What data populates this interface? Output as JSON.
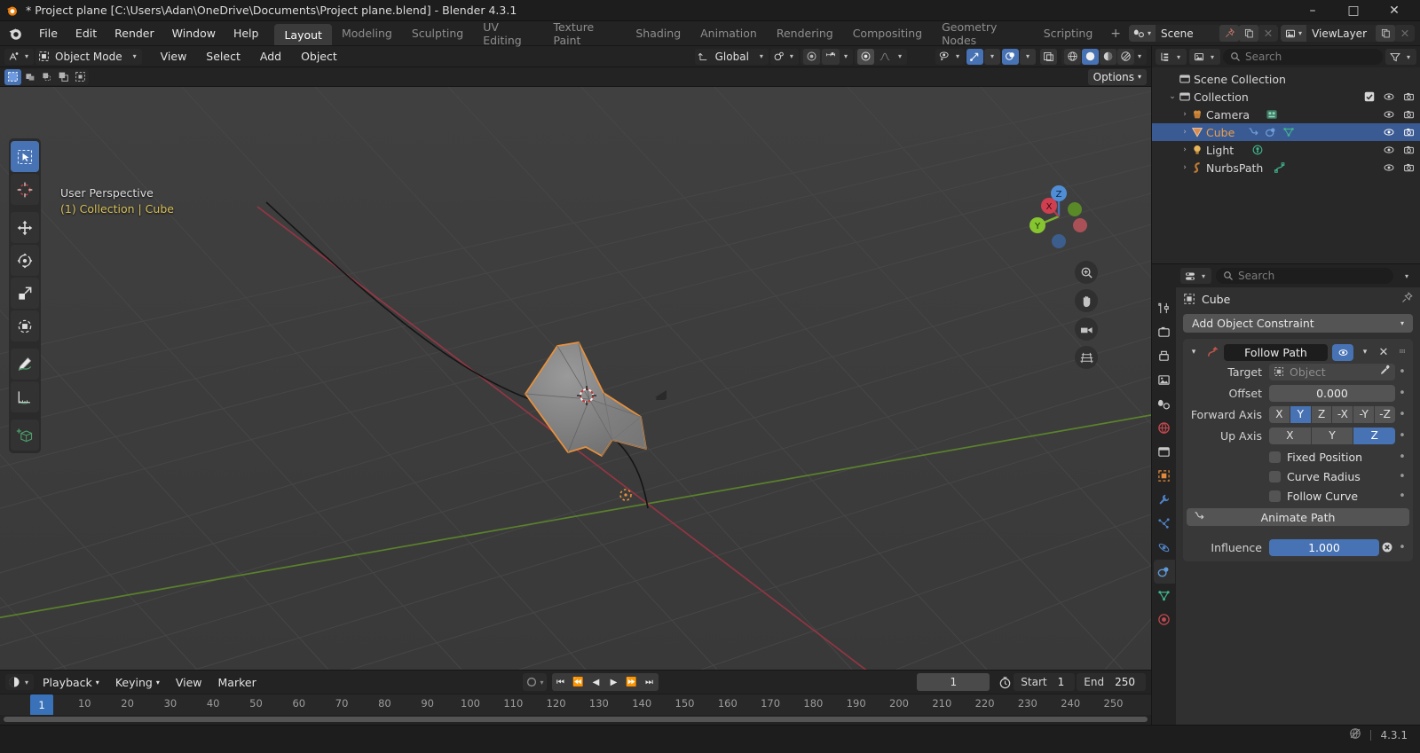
{
  "titlebar": {
    "text": "* Project plane [C:\\Users\\Adan\\OneDrive\\Documents\\Project plane.blend] - Blender 4.3.1",
    "minimize": "–",
    "maximize": "□",
    "close": "✕"
  },
  "topbar": {
    "menus": [
      "File",
      "Edit",
      "Render",
      "Window",
      "Help"
    ],
    "workspaces": [
      {
        "label": "Layout",
        "active": true
      },
      {
        "label": "Modeling",
        "active": false
      },
      {
        "label": "Sculpting",
        "active": false
      },
      {
        "label": "UV Editing",
        "active": false
      },
      {
        "label": "Texture Paint",
        "active": false
      },
      {
        "label": "Shading",
        "active": false
      },
      {
        "label": "Animation",
        "active": false
      },
      {
        "label": "Rendering",
        "active": false
      },
      {
        "label": "Compositing",
        "active": false
      },
      {
        "label": "Geometry Nodes",
        "active": false
      },
      {
        "label": "Scripting",
        "active": false
      }
    ],
    "add_workspace": "+",
    "scene_name": "Scene",
    "viewlayer_name": "ViewLayer"
  },
  "viewport_header": {
    "mode": "Object Mode",
    "menus": [
      "View",
      "Select",
      "Add",
      "Object"
    ],
    "transform_orientation": "Global",
    "options_label": "Options"
  },
  "viewport": {
    "perspective_text": "User Perspective",
    "collection_text": "(1) Collection | Cube",
    "gizmo_axes": [
      "X",
      "Y",
      "Z"
    ]
  },
  "toolbar": {
    "tools": [
      {
        "name": "tweak-tool",
        "active": true
      },
      {
        "name": "cursor-tool",
        "active": false
      },
      {
        "name": "move-tool",
        "active": false
      },
      {
        "name": "rotate-tool",
        "active": false
      },
      {
        "name": "scale-tool",
        "active": false
      },
      {
        "name": "transform-tool",
        "active": false
      },
      {
        "name": "annotate-tool",
        "active": false
      },
      {
        "name": "measure-tool",
        "active": false
      },
      {
        "name": "add-cube-tool",
        "active": false
      }
    ]
  },
  "outliner": {
    "search_placeholder": "Search",
    "rows": [
      {
        "label": "Scene Collection",
        "indent": 0,
        "expand": "",
        "icon": "collection-icon",
        "selected": false,
        "checkbox": false,
        "eye": false,
        "camera": false
      },
      {
        "label": "Collection",
        "indent": 1,
        "expand": "⌄",
        "icon": "collection-icon",
        "selected": false,
        "checkbox": true,
        "eye": true,
        "camera": true
      },
      {
        "label": "Camera",
        "indent": 2,
        "expand": "›",
        "icon": "camera-icon",
        "selected": false,
        "checkbox": false,
        "eye": true,
        "camera": true
      },
      {
        "label": "Cube",
        "indent": 2,
        "expand": "›",
        "icon": "mesh-icon",
        "selected": true,
        "checkbox": false,
        "eye": true,
        "camera": true
      },
      {
        "label": "Light",
        "indent": 2,
        "expand": "›",
        "icon": "light-icon",
        "selected": false,
        "checkbox": false,
        "eye": true,
        "camera": true
      },
      {
        "label": "NurbsPath",
        "indent": 2,
        "expand": "›",
        "icon": "curve-icon",
        "selected": false,
        "checkbox": false,
        "eye": true,
        "camera": true
      }
    ]
  },
  "properties": {
    "search_placeholder": "Search",
    "breadcrumb_object": "Cube",
    "add_constraint_label": "Add Object Constraint",
    "constraint": {
      "title": "Follow Path",
      "target_label": "Target",
      "target_value": "Object",
      "offset_label": "Offset",
      "offset_value": "0.000",
      "forward_axis_label": "Forward Axis",
      "forward_axis_options": [
        "X",
        "Y",
        "Z",
        "-X",
        "-Y",
        "-Z"
      ],
      "forward_axis_selected": "Y",
      "up_axis_label": "Up Axis",
      "up_axis_options": [
        "X",
        "Y",
        "Z"
      ],
      "up_axis_selected": "Z",
      "fixed_position_label": "Fixed Position",
      "fixed_position_checked": false,
      "curve_radius_label": "Curve Radius",
      "curve_radius_checked": false,
      "follow_curve_label": "Follow Curve",
      "follow_curve_checked": false,
      "animate_path_label": "Animate Path",
      "influence_label": "Influence",
      "influence_value": "1.000"
    }
  },
  "timeline": {
    "menus": [
      "Playback",
      "Keying",
      "View",
      "Marker"
    ],
    "current_frame": "1",
    "start_label": "Start",
    "start_value": "1",
    "end_label": "End",
    "end_value": "250",
    "ticks": [
      "1",
      "10",
      "20",
      "30",
      "40",
      "50",
      "60",
      "70",
      "80",
      "90",
      "100",
      "110",
      "120",
      "130",
      "140",
      "150",
      "160",
      "170",
      "180",
      "190",
      "200",
      "210",
      "220",
      "230",
      "240",
      "250"
    ],
    "playhead_frame": "1"
  },
  "statusbar": {
    "version": "4.3.1"
  },
  "colors": {
    "accent_blue": "#4772b3",
    "selected_orange": "#eaa04a",
    "axis_x_red": "#c0384b",
    "axis_y_green": "#6fa832",
    "header_bg": "#232323",
    "panel_bg": "#303030",
    "viewport_bg": "#3b3b3b"
  }
}
